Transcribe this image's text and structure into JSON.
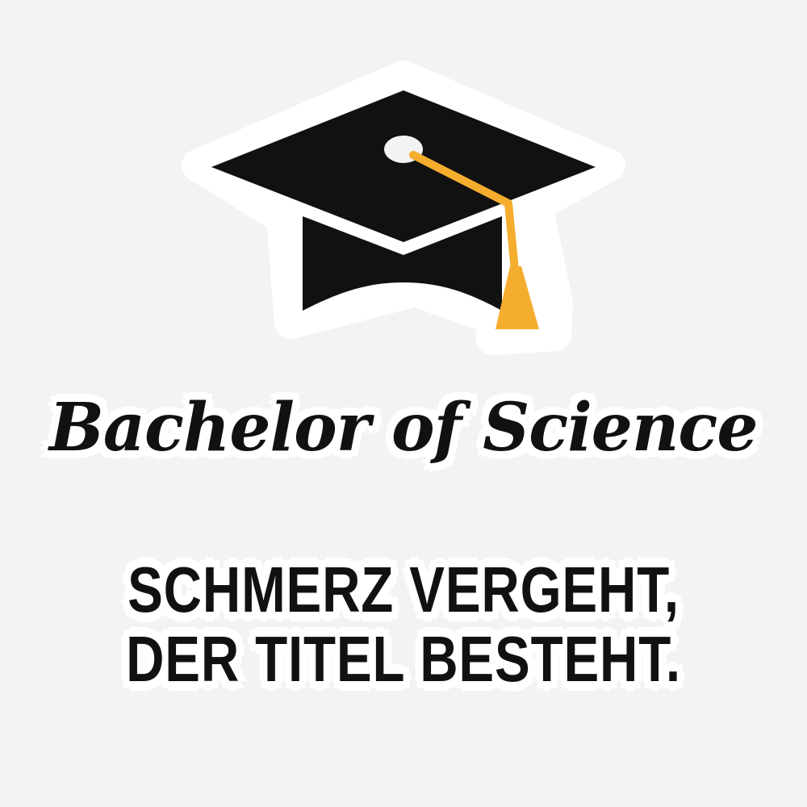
{
  "sticker": {
    "degree": "Bachelor of Science",
    "motto_line_1": "SCHMERZ VERGEHT,",
    "motto_line_2": "DER TITEL BESTEHT."
  },
  "icons": {
    "cap": "graduation-cap-icon",
    "tassel": "tassel-icon"
  },
  "colors": {
    "background": "#f3f3f3",
    "ink": "#111111",
    "sticker_border": "#ffffff",
    "tassel": "#f5ad2e"
  }
}
